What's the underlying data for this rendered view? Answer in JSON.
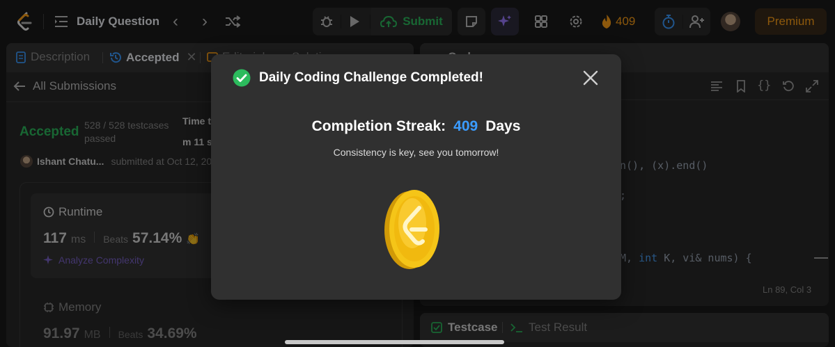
{
  "header": {
    "list_label": "Daily Question",
    "submit_label": "Submit",
    "streak_count": "409",
    "premium_label": "Premium"
  },
  "left_panel": {
    "tabs": [
      "Description",
      "Accepted",
      "Editorial",
      "Solutions"
    ],
    "back_label": "All Submissions",
    "status": "Accepted",
    "testcases_line1": "528 / 528 testcases",
    "testcases_line2": "passed",
    "time_label_partial": "Time t",
    "time_value_partial": "m 11 s",
    "user_name": "Ishant Chatu...",
    "submitted_text": "submitted at Oct 12, 20",
    "runtime": {
      "title": "Runtime",
      "value": "117",
      "unit": "ms",
      "beats_label": "Beats",
      "beats_value": "57.14%",
      "analyze_label": "Analyze Complexity"
    },
    "memory": {
      "title": "Memory",
      "value": "91.97",
      "unit": "MB",
      "beats_label": "Beats",
      "beats_value": "34.69%"
    }
  },
  "right_panel": {
    "code_tab": "Code",
    "code_fragment_1": "n(), (x).end()",
    "code_fragment_2": ";",
    "code_fragment_3_a": "M, ",
    "code_fragment_3_kw": "int",
    "code_fragment_3_b": " K, vi& nums) {",
    "cursor_pos": "Ln 89, Col 3",
    "testcase_tab": "Testcase",
    "test_result_tab": "Test Result"
  },
  "modal": {
    "title": "Daily Coding Challenge Completed!",
    "streak_prefix": "Completion Streak:",
    "streak_number": "409",
    "streak_suffix": "Days",
    "subtitle": "Consistency is key, see you tomorrow!"
  },
  "colors": {
    "accent_blue": "#3b9cff",
    "success_green": "#2cbb5d",
    "fire_orange": "#ffa116",
    "coin_gold": "#f5c518"
  }
}
